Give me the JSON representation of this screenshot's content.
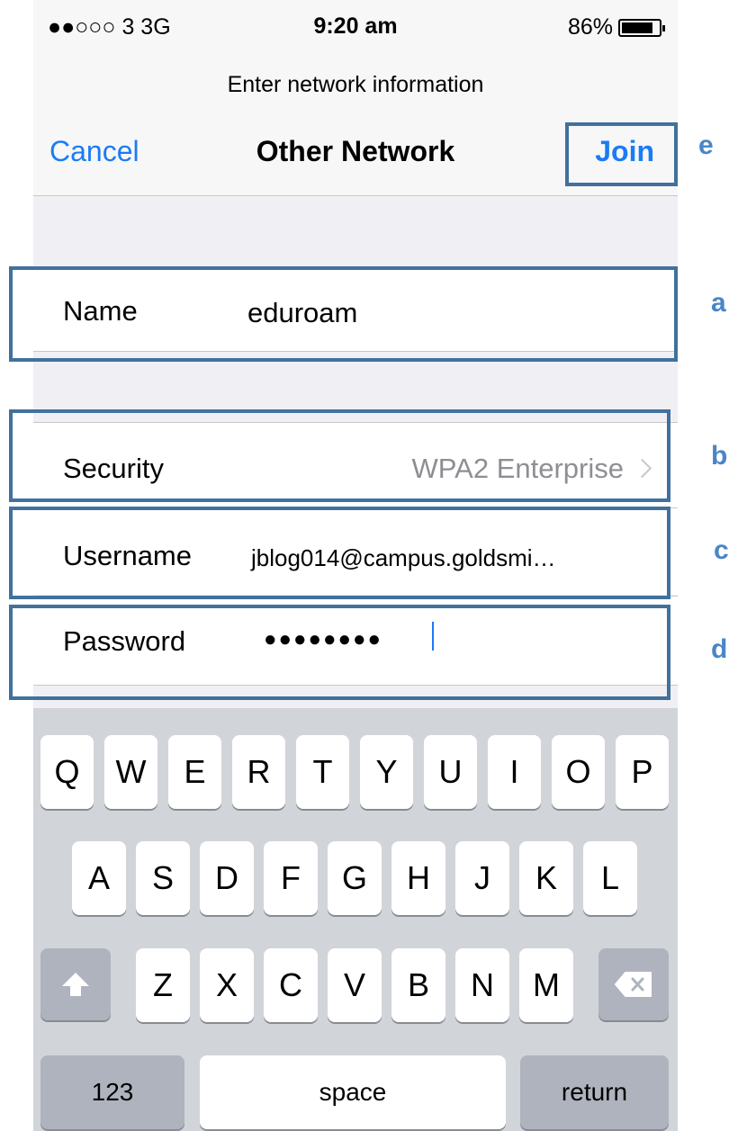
{
  "status_bar": {
    "carrier": "●●○○○ 3   3G",
    "time": "9:20 am",
    "battery_percent": "86%",
    "battery_level": 0.86
  },
  "nav": {
    "prompt": "Enter network information",
    "cancel_label": "Cancel",
    "title": "Other Network",
    "join_label": "Join"
  },
  "form": {
    "name_label": "Name",
    "name_value": "eduroam",
    "security_label": "Security",
    "security_value": "WPA2 Enterprise",
    "username_label": "Username",
    "username_value": "jblog014@campus.goldsmi…",
    "password_label": "Password",
    "password_value": "●●●●●●●●"
  },
  "keyboard": {
    "row1": [
      "Q",
      "W",
      "E",
      "R",
      "T",
      "Y",
      "U",
      "I",
      "O",
      "P"
    ],
    "row2": [
      "A",
      "S",
      "D",
      "F",
      "G",
      "H",
      "J",
      "K",
      "L"
    ],
    "row3": [
      "Z",
      "X",
      "C",
      "V",
      "B",
      "N",
      "M"
    ],
    "numbers_label": "123",
    "space_label": "space",
    "return_label": "return"
  },
  "annotations": [
    "a",
    "b",
    "c",
    "d",
    "e"
  ],
  "colors": {
    "accent": "#1a7cf5",
    "annotation_border": "#41719c",
    "annotation_letter": "#4a86c5"
  }
}
